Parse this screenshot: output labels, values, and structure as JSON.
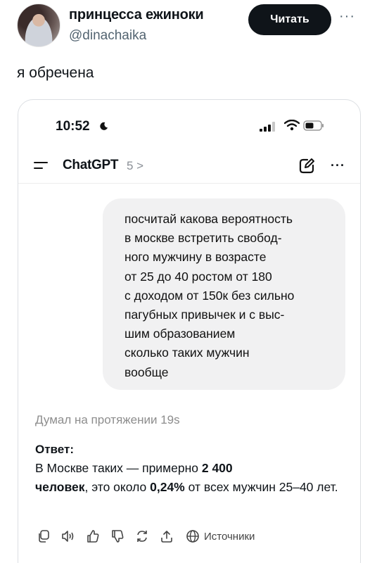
{
  "tweet": {
    "author_name": "принцесса ежиноки",
    "author_handle": "@dinachaika",
    "follow_label": "Читать",
    "more": "···",
    "text": "я обречена"
  },
  "screenshot": {
    "status_time": "10:52",
    "app_title": "ChatGPT",
    "model_version": "5 >",
    "more": "···",
    "user_message_lines": [
      "посчитай какова вероятность",
      "в москве встретить свобод-",
      "ного мужчину в возрасте",
      "от 25 до 40 ростом от 180",
      "с доходом от 150к без сильно",
      "пагубных привычек и с выс-",
      "шим образованием",
      "сколько таких мужчин",
      "вообще"
    ],
    "thinking_text": "Думал на протяжении 19s",
    "answer_label": "Ответ:",
    "answer": {
      "part1": "В Москве таких — примерно ",
      "count": "2 400",
      "unit": "человек",
      "part2": ", это около ",
      "percent": "0,24%",
      "part3": " от всех мужчин 25–40 лет."
    },
    "sources_label": "Источники"
  }
}
